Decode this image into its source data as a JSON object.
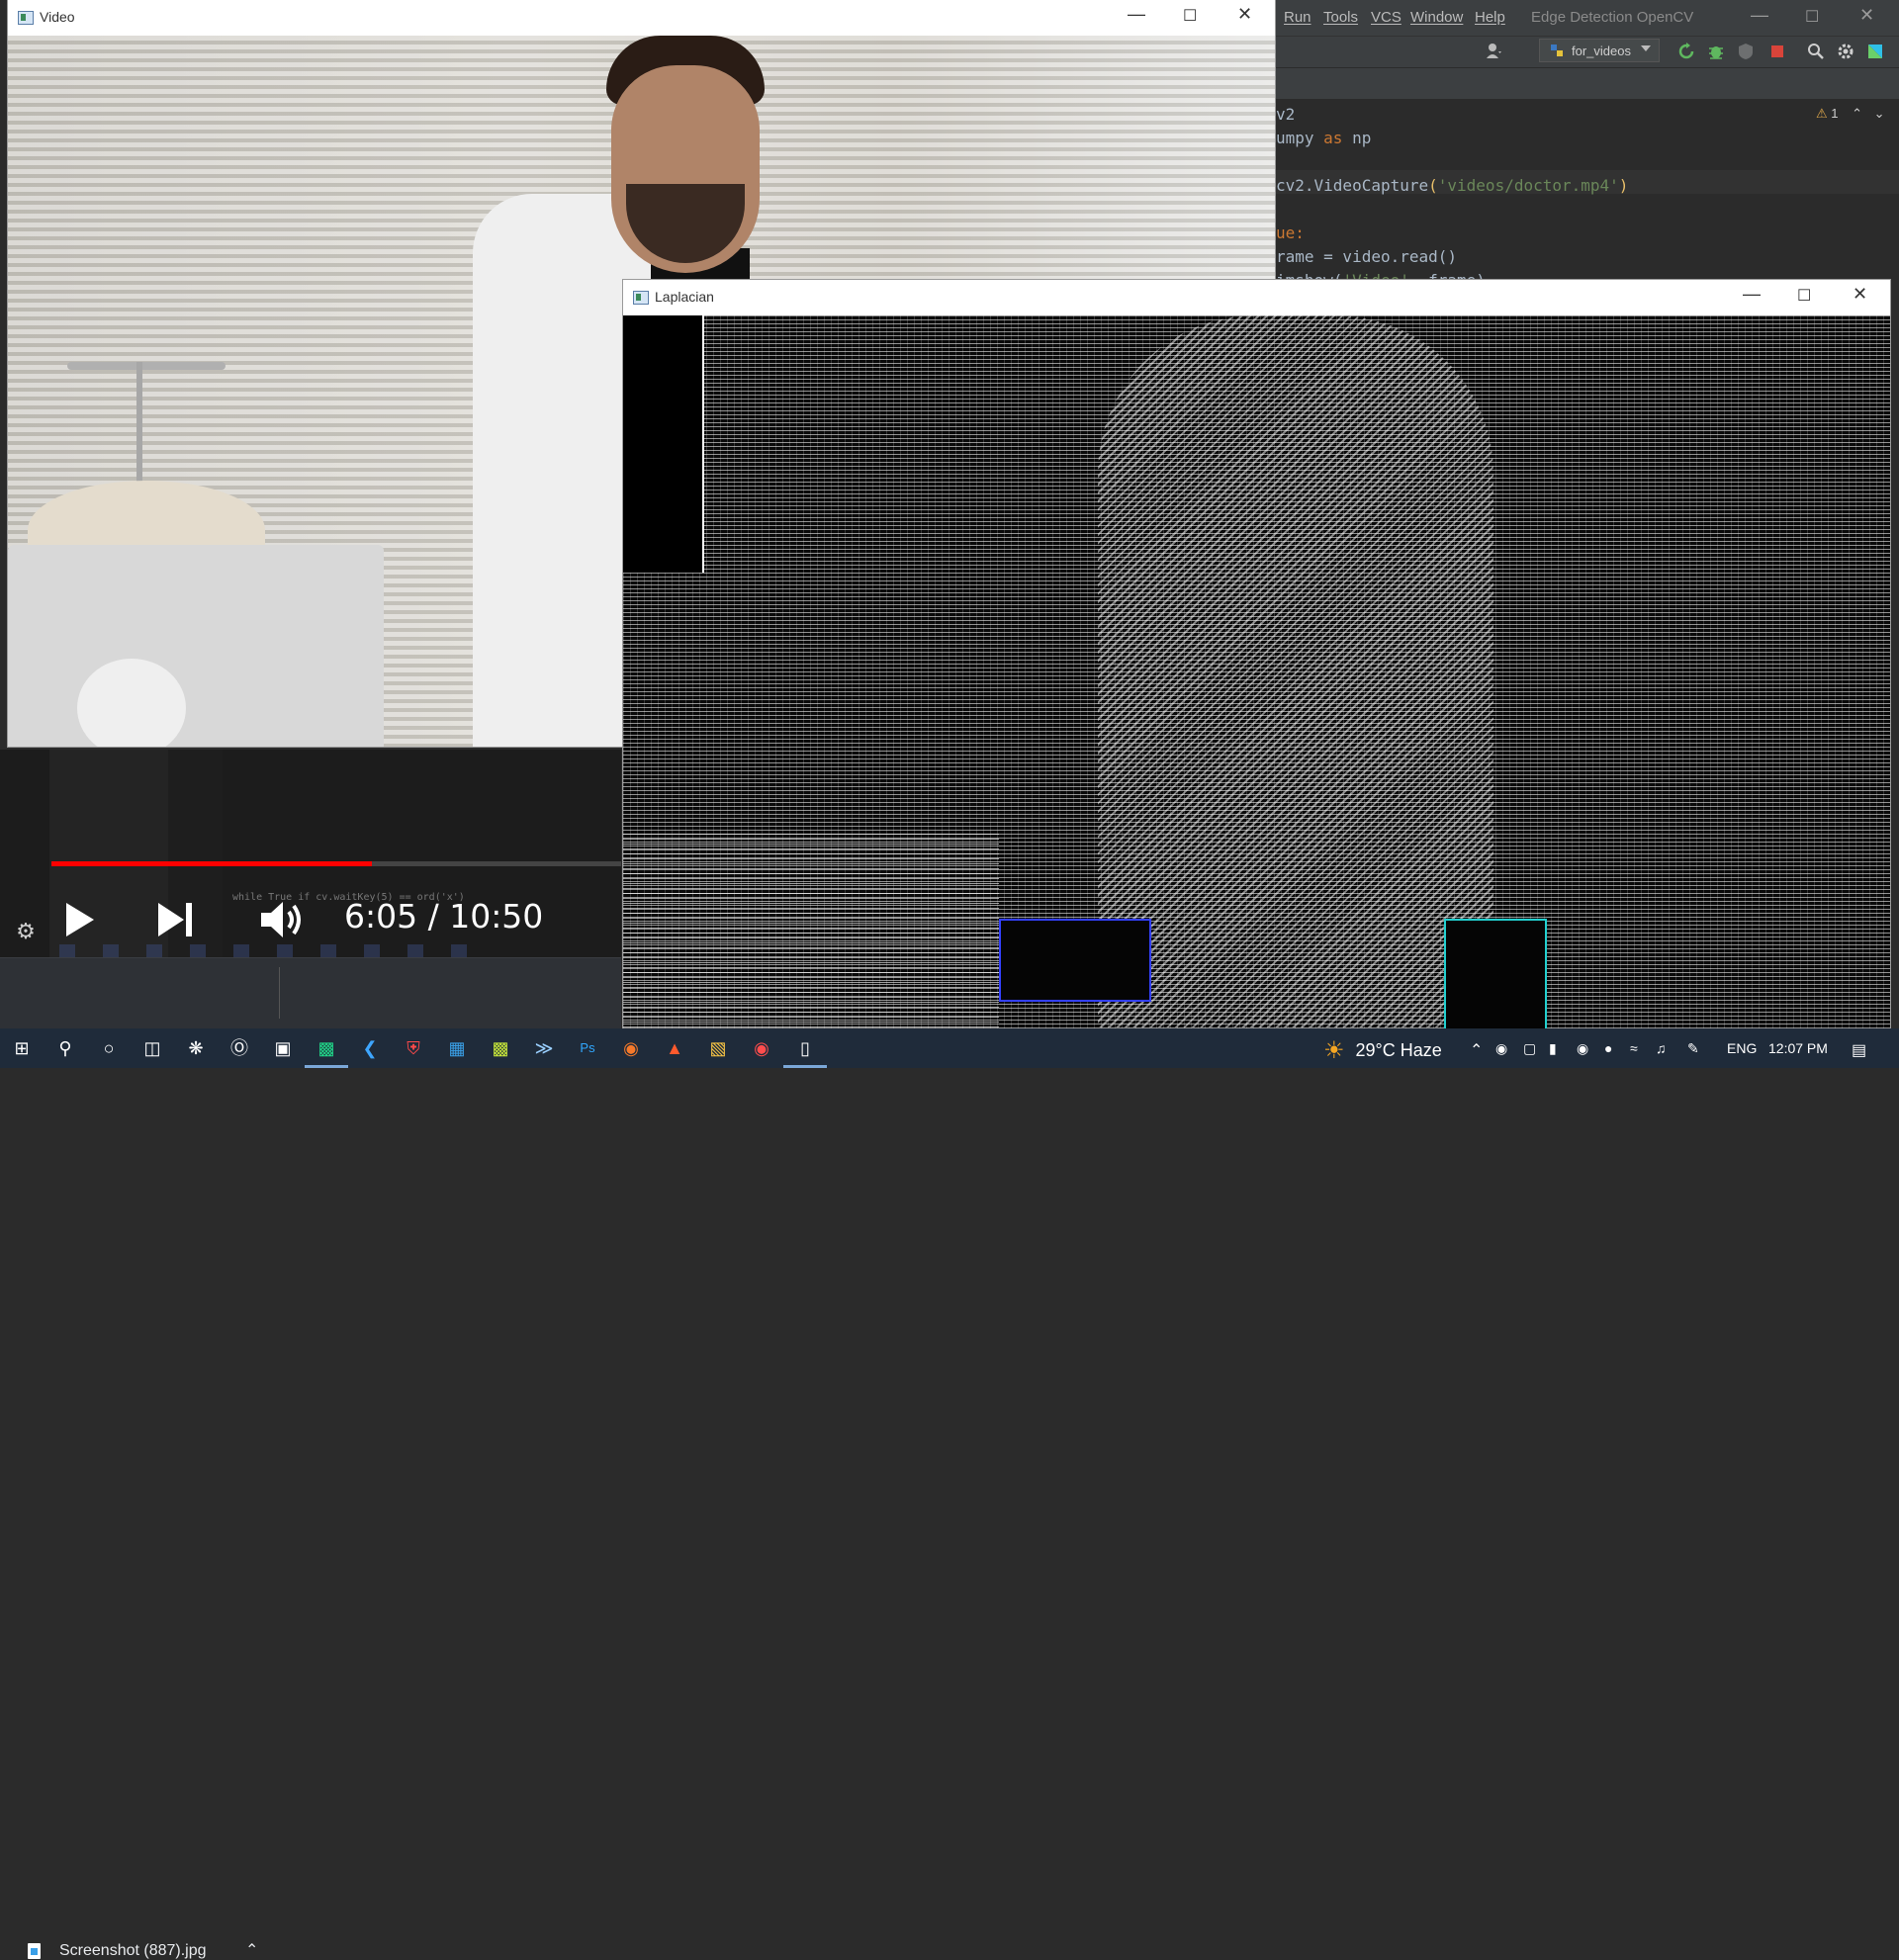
{
  "ide": {
    "menu": [
      "Run",
      "Tools",
      "VCS",
      "Window",
      "Help"
    ],
    "title": "Edge Detection OpenCV",
    "run_config": "for_videos",
    "warning_count": "1",
    "code_lines": [
      {
        "parts": [
          {
            "t": "v2",
            "c": "#a9b7c6"
          }
        ]
      },
      {
        "parts": [
          {
            "t": "umpy ",
            "c": "#a9b7c6"
          },
          {
            "t": "as",
            "c": "#cc7832"
          },
          {
            "t": " np",
            "c": "#a9b7c6"
          }
        ]
      },
      {
        "parts": [
          {
            "t": "",
            "c": "#a9b7c6"
          }
        ]
      },
      {
        "parts": [
          {
            "t": "cv2.VideoCapture",
            "c": "#a9b7c6"
          },
          {
            "t": "(",
            "c": "#e8bf6a"
          },
          {
            "t": "'videos/doctor.mp4'",
            "c": "#6a8759"
          },
          {
            "t": ")",
            "c": "#e8bf6a"
          }
        ]
      },
      {
        "parts": [
          {
            "t": "",
            "c": "#a9b7c6"
          }
        ]
      },
      {
        "parts": [
          {
            "t": "ue",
            "c": "#cc7832"
          },
          {
            "t": ":",
            "c": "#cc7832"
          }
        ]
      },
      {
        "parts": [
          {
            "t": "rame = video.read()",
            "c": "#a9b7c6"
          }
        ]
      },
      {
        "parts": [
          {
            "t": "imshow(",
            "c": "#a9b7c6"
          },
          {
            "t": "'Video'",
            "c": "#6a8759"
          },
          {
            "t": ", frame)",
            "c": "#a9b7c6"
          }
        ]
      }
    ]
  },
  "video_window": {
    "title": "Video"
  },
  "laplacian_window": {
    "title": "Laplacian"
  },
  "player": {
    "time": "6:05 / 10:50",
    "progress": 0.562,
    "faint_code": "while True     if cv.waitKey(5) == ord('x')"
  },
  "download": {
    "file_name": "Screenshot (887).jpg"
  },
  "taskbar": {
    "weather": "29°C  Haze",
    "language": "ENG",
    "clock": "12:07 PM",
    "apps": [
      "start-icon",
      "search-icon",
      "cortana-icon",
      "task-view-icon",
      "app-icon",
      "unreal-icon",
      "epic-icon",
      "pycharm-icon",
      "vscode-icon",
      "shield-app-icon",
      "store-icon",
      "pycharm-ce-icon",
      "powershell-icon",
      "photoshop-icon",
      "blender-icon",
      "brave-icon",
      "file-explorer-icon",
      "record-icon",
      "notepad-icon"
    ]
  },
  "colors": {
    "ide_bg": "#2b2b2b",
    "progress_red": "#ff0000",
    "taskbar": "#1f2b3a"
  }
}
